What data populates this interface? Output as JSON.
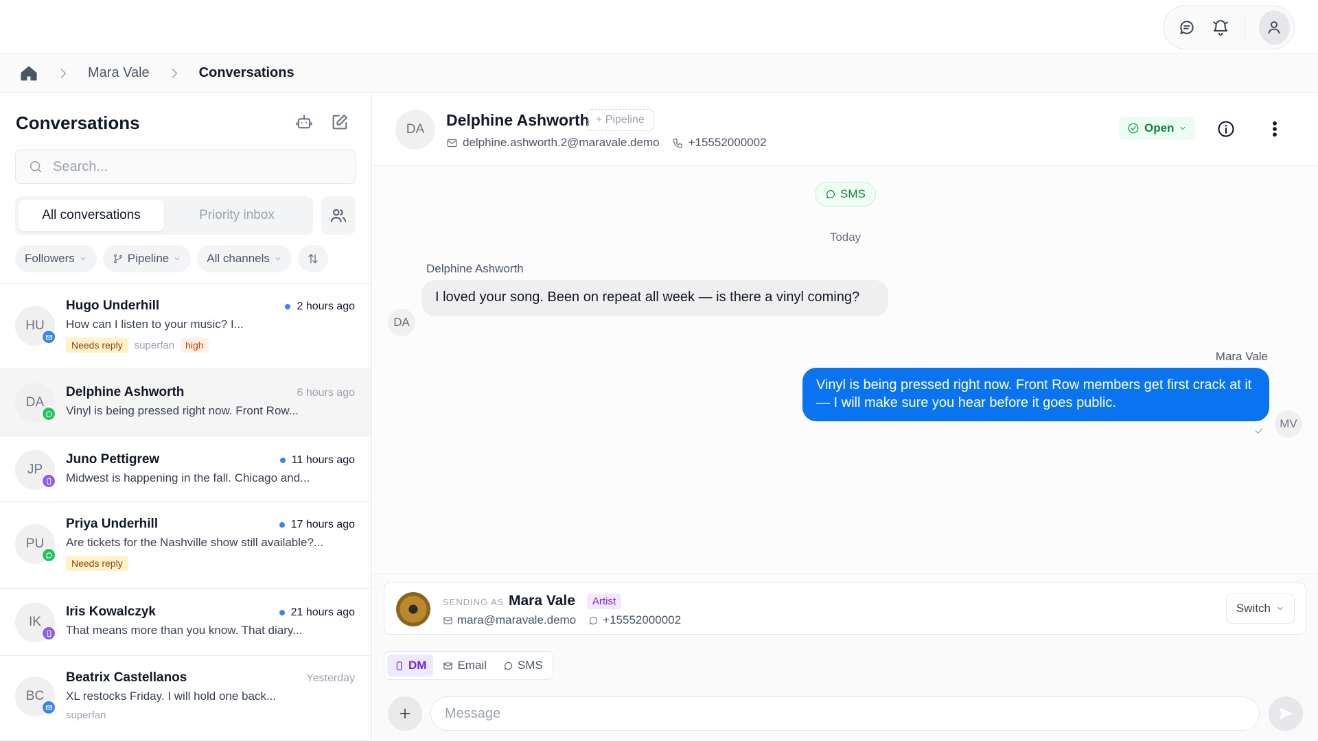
{
  "breadcrumb": {
    "items": [
      "Mara Vale",
      "Conversations"
    ]
  },
  "sidebar": {
    "title": "Conversations",
    "search_placeholder": "Search...",
    "tabs": [
      {
        "label": "All conversations",
        "active": true
      },
      {
        "label": "Priority inbox",
        "active": false
      }
    ],
    "filters": {
      "followers": "Followers",
      "pipeline": "Pipeline",
      "channels": "All channels"
    },
    "conversations": [
      {
        "initials": "HU",
        "name": "Hugo Underhill",
        "time": "2 hours ago",
        "unread": true,
        "channel": "email",
        "preview": "How can I listen to your music? I...",
        "tags": [
          {
            "text": "Needs reply",
            "style": "yellow"
          },
          {
            "text": "superfan",
            "style": "plain"
          },
          {
            "text": "high",
            "style": "orange"
          }
        ]
      },
      {
        "initials": "DA",
        "name": "Delphine Ashworth",
        "time": "6 hours ago",
        "unread": false,
        "channel": "sms",
        "preview": "Vinyl is being pressed right now. Front Row...",
        "tags": []
      },
      {
        "initials": "JP",
        "name": "Juno Pettigrew",
        "time": "11 hours ago",
        "unread": true,
        "channel": "dm",
        "preview": "Midwest is happening in the fall. Chicago and...",
        "tags": []
      },
      {
        "initials": "PU",
        "name": "Priya Underhill",
        "time": "17 hours ago",
        "unread": true,
        "channel": "sms",
        "preview": "Are tickets for the Nashville show still available?...",
        "tags": [
          {
            "text": "Needs reply",
            "style": "yellow"
          }
        ]
      },
      {
        "initials": "IK",
        "name": "Iris Kowalczyk",
        "time": "21 hours ago",
        "unread": true,
        "channel": "dm",
        "preview": "That means more than you know. That diary...",
        "tags": []
      },
      {
        "initials": "BC",
        "name": "Beatrix Castellanos",
        "time": "Yesterday",
        "unread": false,
        "channel": "email",
        "preview": "XL restocks Friday. I will hold one back...",
        "tags": [
          {
            "text": "superfan",
            "style": "plain"
          }
        ]
      }
    ]
  },
  "chat": {
    "contact": {
      "initials": "DA",
      "name": "Delphine Ashworth",
      "pipeline_label": "+ Pipeline",
      "email": "delphine.ashworth.2@maravale.demo",
      "phone": "+15552000002",
      "status": "Open"
    },
    "channel_pill": "SMS",
    "day_label": "Today",
    "messages": [
      {
        "direction": "in",
        "sender": "Delphine Ashworth",
        "initials": "DA",
        "text": "I loved your song. Been on repeat all week — is there a vinyl coming?"
      },
      {
        "direction": "out",
        "sender": "Mara Vale",
        "initials": "MV",
        "text": "Vinyl is being pressed right now. Front Row members get first crack at it — I will make sure you hear before it goes public."
      }
    ]
  },
  "composer": {
    "sending_as_label": "SENDING AS",
    "sender_name": "Mara Vale",
    "sender_role": "Artist",
    "sender_email": "mara@maravale.demo",
    "sender_phone": "+15552000002",
    "switch_label": "Switch",
    "channel_tabs": [
      {
        "label": "DM",
        "active": true
      },
      {
        "label": "Email",
        "active": false
      },
      {
        "label": "SMS",
        "active": false
      }
    ],
    "placeholder": "Message"
  },
  "colors": {
    "accent_blue": "#0a74f0",
    "open_green": "#15803d",
    "dm_purple": "#6d28d9"
  }
}
